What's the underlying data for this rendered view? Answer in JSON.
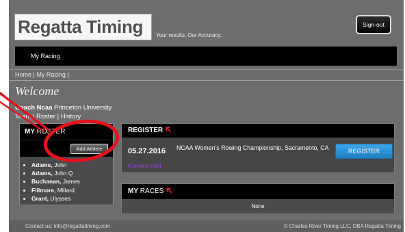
{
  "brand": {
    "logo_text": "Regatta Timing",
    "tagline": "Your results. Our Accuracy."
  },
  "header": {
    "sign_out_label": "Sign-out"
  },
  "nav": {
    "items": [
      {
        "label": "My Racing"
      }
    ]
  },
  "breadcrumb": {
    "items": [
      "Home",
      "My Racing"
    ],
    "separator": "|"
  },
  "welcome": {
    "title": "Welcome",
    "user_name": "Coach Ncaa",
    "organization": "Princeton University",
    "links": [
      "Team",
      "Roster",
      "History"
    ],
    "link_separator": "|"
  },
  "roster": {
    "title_bold": "MY",
    "title_rest": "ROSTER",
    "add_button_label": "Add Athlete",
    "name_separator": ",",
    "athletes": [
      {
        "last": "Adams",
        "first": "John"
      },
      {
        "last": "Adams",
        "first": "John Q"
      },
      {
        "last": "Buchanan",
        "first": "James"
      },
      {
        "last": "Fillmore",
        "first": "Millard"
      },
      {
        "last": "Grant",
        "first": "Ulysses"
      }
    ]
  },
  "register": {
    "title": "REGISTER",
    "events": [
      {
        "date": "05.27.2016",
        "name": "NCAA Women's Rowing Championship, Sacramento, CA",
        "button_label": "REGISTER",
        "info_link": "[General Info]"
      }
    ]
  },
  "races": {
    "title_bold": "MY",
    "title_rest": "RACES",
    "empty_text": "None"
  },
  "footer": {
    "contact": "Contact us: info@regattatiming.com",
    "copyright": "© Charles River Timing LLC, DBA Regatta Timing"
  },
  "icons": {
    "section_header": "arrow-up-left-icon"
  },
  "colors": {
    "page_bg": "#6d6d6d",
    "bar_bg": "#000000",
    "register_button": "#2b8fd6",
    "info_link": "#a53ee6",
    "section_arrow": "#e3262d",
    "annotation": "#e3141c"
  }
}
